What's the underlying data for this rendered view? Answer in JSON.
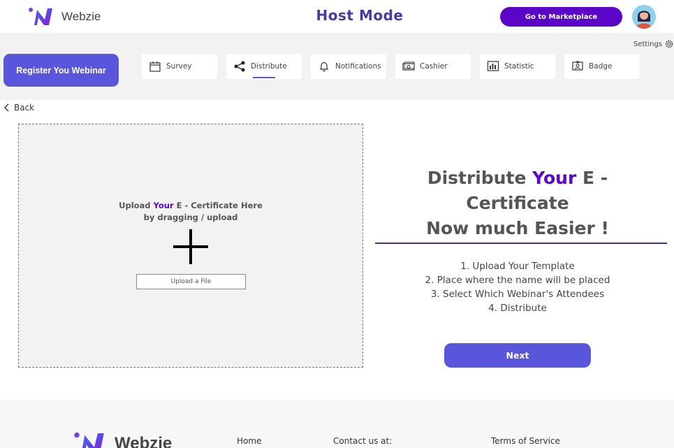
{
  "header": {
    "logo_text": "Webzie",
    "title": "Host Mode",
    "marketplace_button": "Go to Marketplace",
    "brand_color": "#5b05c9",
    "title_color": "#4b3a9e"
  },
  "toolbar": {
    "settings_label": "Settings",
    "register_button": "Register You Webinar",
    "active_tab": "Distribute",
    "tabs": [
      {
        "label": "Survey",
        "icon": "calendar-icon"
      },
      {
        "label": "Distribute",
        "icon": "share-icon"
      },
      {
        "label": "Notifications",
        "icon": "bell-icon"
      },
      {
        "label": "Cashier",
        "icon": "cash-icon"
      },
      {
        "label": "Statistic",
        "icon": "bar-chart-icon"
      },
      {
        "label": "Badge",
        "icon": "badge-icon"
      }
    ],
    "accent_color": "#5a56dc"
  },
  "main": {
    "back_label": "Back",
    "upload": {
      "line1_prefix": "Upload ",
      "line1_accent": "Your",
      "line1_suffix": " E - Certificate Here",
      "line2": "by dragging / upload",
      "button": "Upload a File"
    },
    "headline": {
      "prefix": "Distribute ",
      "accent": "Your",
      "suffix": " E - Certificate",
      "line2": "Now much Easier !"
    },
    "steps": [
      "1. Upload Your Template",
      "2. Place where the name will be placed",
      "3. Select Which Webinar's Attendees",
      "4. Distribute"
    ],
    "next_button": "Next"
  },
  "footer": {
    "logo_text": "Webzie",
    "links": [
      "Home",
      "Contact us at:",
      "Terms of Service"
    ]
  }
}
